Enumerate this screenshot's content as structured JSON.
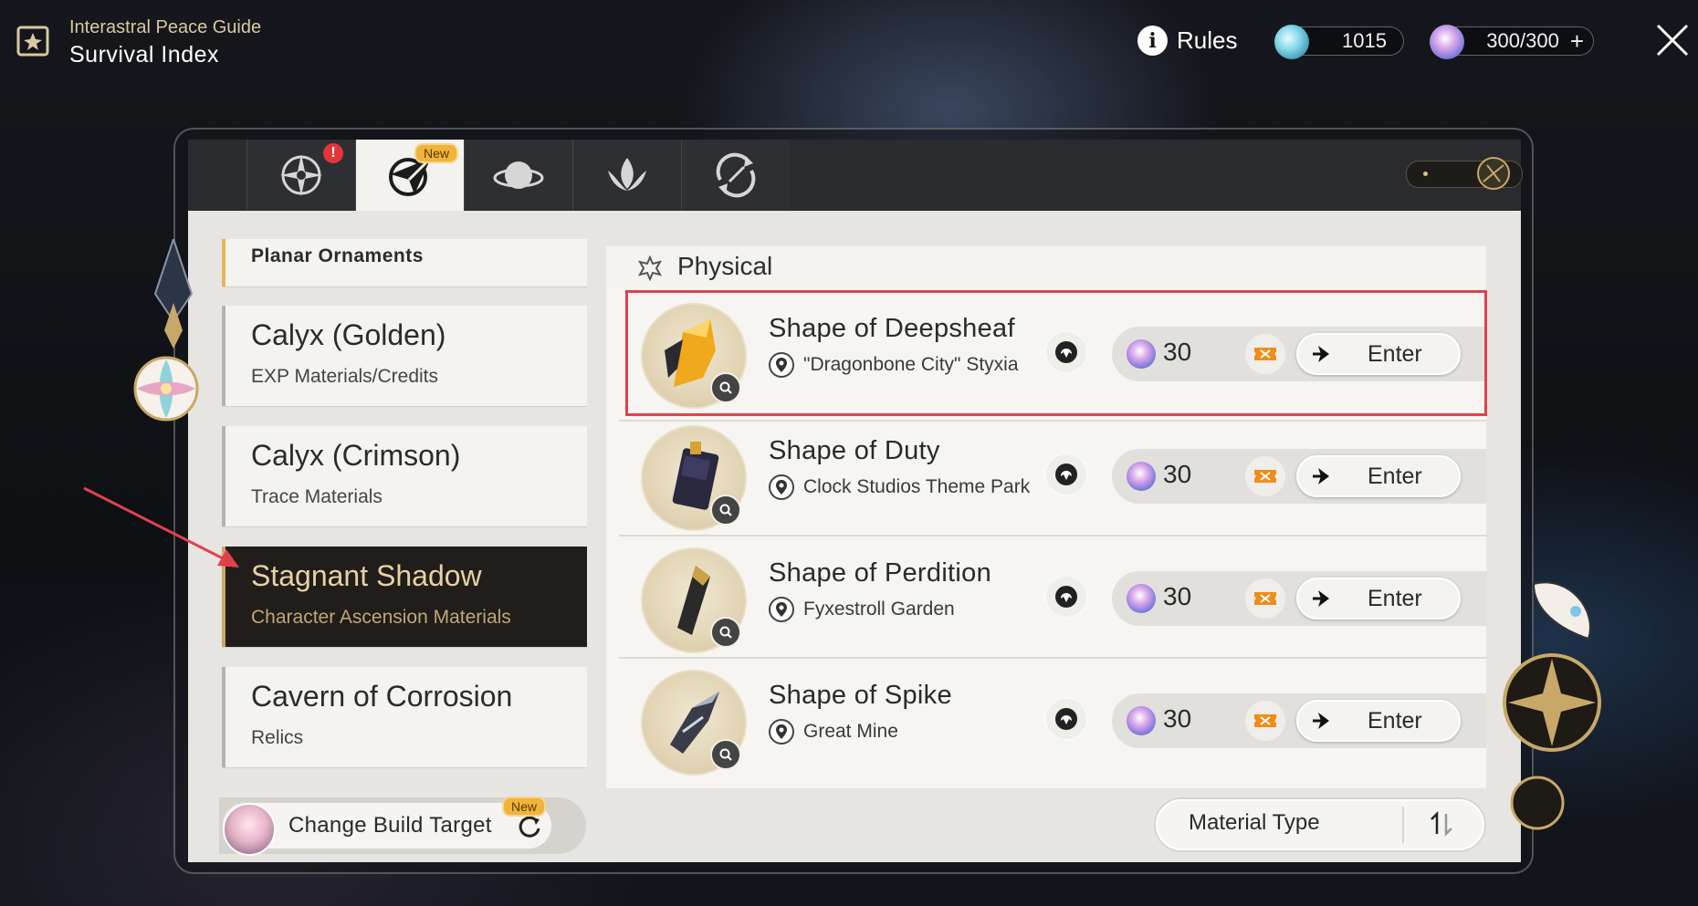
{
  "header": {
    "subtitle": "Interastral Peace Guide",
    "title": "Survival Index",
    "rules_label": "Rules",
    "stellar_jade": "1015",
    "trailblaze_power": "300/300",
    "add_symbol": "+"
  },
  "tabs": [
    {
      "icon": "compass-star-icon",
      "badge": "!"
    },
    {
      "icon": "paper-plane-icon",
      "badge": "New",
      "active": true
    },
    {
      "icon": "planet-icon"
    },
    {
      "icon": "lotus-icon"
    },
    {
      "icon": "cycle-icon"
    }
  ],
  "categories": [
    {
      "title": "Planar Ornaments",
      "subtitle": ""
    },
    {
      "title": "Calyx (Golden)",
      "subtitle": "EXP Materials/Credits"
    },
    {
      "title": "Calyx (Crimson)",
      "subtitle": "Trace Materials"
    },
    {
      "title": "Stagnant Shadow",
      "subtitle": "Character Ascension Materials",
      "active": true
    },
    {
      "title": "Cavern of Corrosion",
      "subtitle": "Relics"
    }
  ],
  "section": {
    "label": "Physical"
  },
  "rows": [
    {
      "name": "Shape of Deepsheaf",
      "location": "\"Dragonbone City\" Styxia",
      "cost": "30",
      "enter": "Enter"
    },
    {
      "name": "Shape of Duty",
      "location": "Clock Studios Theme Park",
      "cost": "30",
      "enter": "Enter"
    },
    {
      "name": "Shape of Perdition",
      "location": "Fyxestroll Garden",
      "cost": "30",
      "enter": "Enter"
    },
    {
      "name": "Shape of Spike",
      "location": "Great Mine",
      "cost": "30",
      "enter": "Enter"
    }
  ],
  "footer": {
    "change_build_label": "Change Build Target",
    "new_badge": "New",
    "material_type_label": "Material Type"
  },
  "colors": {
    "accent_gold": "#c8a868",
    "highlight_red": "#e0424c",
    "new_badge": "#f0b33b",
    "alert_red": "#e3353a"
  }
}
